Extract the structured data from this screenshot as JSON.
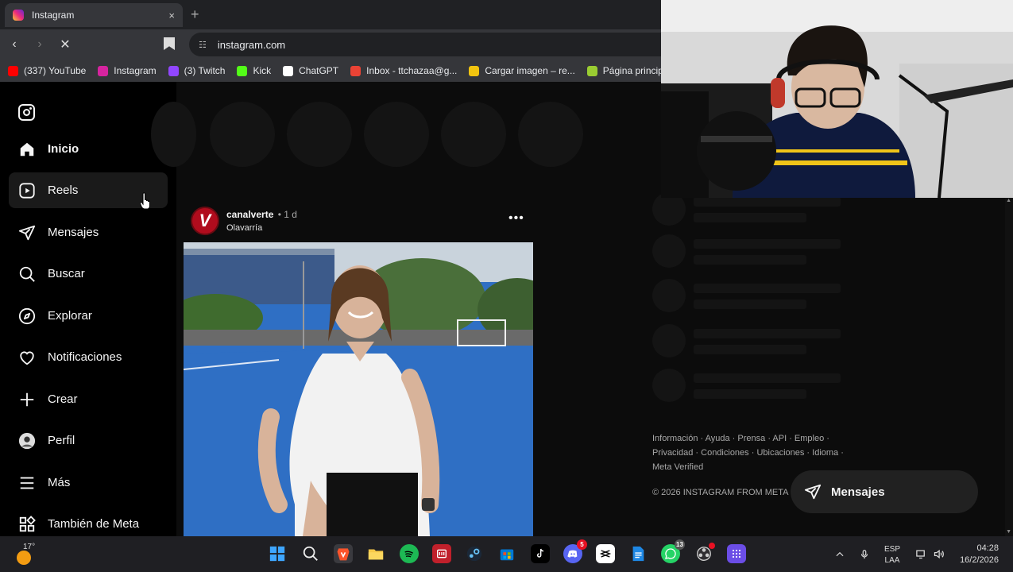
{
  "browser": {
    "tab_title": "Instagram",
    "tab_close": "×",
    "new_tab": "+",
    "url": "instagram.com",
    "bookmarks": [
      {
        "label": "(337) YouTube",
        "color": "#ff0000"
      },
      {
        "label": "Instagram",
        "color": "#d6249f"
      },
      {
        "label": "(3) Twitch",
        "color": "#9146ff"
      },
      {
        "label": "Kick",
        "color": "#53fc18"
      },
      {
        "label": "ChatGPT",
        "color": "#ffffff"
      },
      {
        "label": "Inbox - ttchazaa@g...",
        "color": "#ea4335"
      },
      {
        "label": "Cargar imagen – re...",
        "color": "#f1c40f"
      },
      {
        "label": "Página principal",
        "color": "#9acd32"
      }
    ]
  },
  "sidebar": {
    "items": [
      {
        "label": "Inicio",
        "icon": "home-icon"
      },
      {
        "label": "Reels",
        "icon": "reels-icon"
      },
      {
        "label": "Mensajes",
        "icon": "send-icon"
      },
      {
        "label": "Buscar",
        "icon": "search-icon"
      },
      {
        "label": "Explorar",
        "icon": "compass-icon"
      },
      {
        "label": "Notificaciones",
        "icon": "heart-icon"
      },
      {
        "label": "Crear",
        "icon": "plus-icon"
      },
      {
        "label": "Perfil",
        "icon": "profile-avatar"
      },
      {
        "label": "Más",
        "icon": "menu-icon"
      },
      {
        "label": "También de Meta",
        "icon": "meta-apps-icon"
      }
    ]
  },
  "post": {
    "username": "canalverte",
    "time": "• 1 d",
    "location": "Olavarría",
    "avatar_letter": "V",
    "more": "•••"
  },
  "footer": {
    "links_line1": "Información · Ayuda · Prensa · API · Empleo ·",
    "links_line2": "Privacidad · Condiciones · Ubicaciones · Idioma ·",
    "links_line3": "Meta Verified",
    "copyright": "© 2026 INSTAGRAM FROM META"
  },
  "messages_button": "Mensajes",
  "taskbar": {
    "temperature": "17°",
    "discord_badge": "5",
    "whatsapp_badge": "13",
    "lang_line1": "ESP",
    "lang_line2": "LAA",
    "time": "04:28",
    "date": "16/2/2026"
  },
  "colors": {
    "page_bg": "#0c0c0c",
    "sidebar_bg": "#000000",
    "skeleton": "#141414",
    "taskbar_bg": "#1f1f23"
  }
}
